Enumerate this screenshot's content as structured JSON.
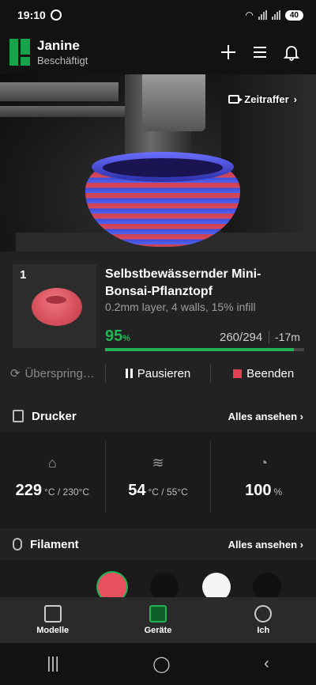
{
  "status_bar": {
    "time": "19:10",
    "battery": "40"
  },
  "header": {
    "printer_name": "Janine",
    "printer_status": "Beschäftigt"
  },
  "camera": {
    "timelapse_label": "Zeitraffer"
  },
  "job": {
    "slot": "1",
    "title": "Selbstbewässernder Mini-Bonsai-Pflanztopf",
    "settings": "0.2mm layer, 4 walls, 15% infill",
    "progress_value": "95",
    "progress_unit": "%",
    "progress_fraction": 0.95,
    "layers": "260/294",
    "remaining": "-17m",
    "skip_label": "Überspring…",
    "pause_label": "Pausieren",
    "stop_label": "Beenden"
  },
  "printer": {
    "section_label": "Drucker",
    "see_all": "Alles ansehen",
    "nozzle_value": "229",
    "nozzle_unit": "°C / 230°C",
    "bed_value": "54",
    "bed_unit": "°C / 55°C",
    "fan_value": "100",
    "fan_unit": "%"
  },
  "filament": {
    "section_label": "Filament",
    "see_all": "Alles ansehen",
    "spools": [
      "#e8525f",
      "#111111",
      "#f5f5f5",
      "#111111"
    ]
  },
  "bottom_nav": {
    "models": "Modelle",
    "devices": "Geräte",
    "me": "Ich"
  },
  "colors": {
    "accent": "#21b356",
    "stop": "#e0414e"
  }
}
